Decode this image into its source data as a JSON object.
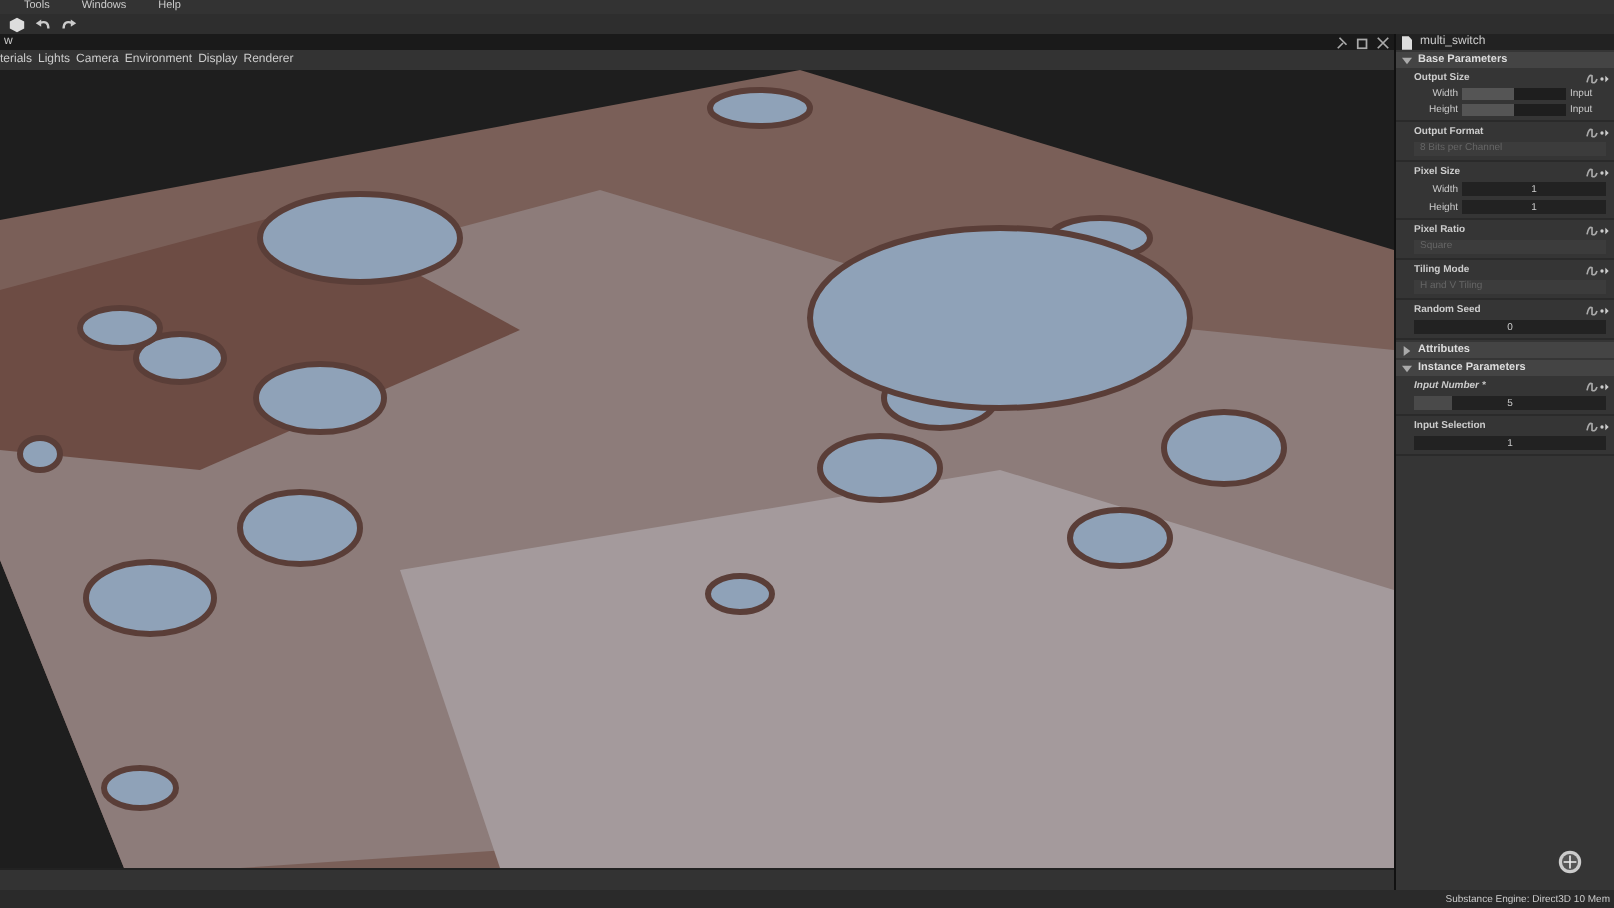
{
  "menu": [
    "Tools",
    "Windows",
    "Help"
  ],
  "viewport": {
    "title": "w",
    "menu": [
      "terials",
      "Lights",
      "Camera",
      "Environment",
      "Display",
      "Renderer"
    ],
    "kind": "picture"
  },
  "panel": {
    "title": "multi_switch",
    "sections": [
      {
        "title": "Base Parameters",
        "expanded": true,
        "groups": [
          {
            "label": "Output Size",
            "italic": false,
            "fields": [
              {
                "label": "Width",
                "kind": "slider",
                "level": 0.5,
                "extra": "Input"
              },
              {
                "label": "Height",
                "kind": "slider",
                "level": 0.5,
                "extra": "Input"
              }
            ]
          },
          {
            "label": "Output Format",
            "italic": false,
            "fields": [
              {
                "kind": "combo",
                "value": "8 Bits per Channel",
                "disabled": true
              }
            ]
          },
          {
            "label": "Pixel Size",
            "italic": false,
            "fields": [
              {
                "label": "Width",
                "kind": "number",
                "value": "1"
              },
              {
                "label": "Height",
                "kind": "number",
                "value": "1"
              }
            ]
          },
          {
            "label": "Pixel Ratio",
            "italic": false,
            "fields": [
              {
                "kind": "combo",
                "value": "Square",
                "disabled": true
              }
            ]
          },
          {
            "label": "Tiling Mode",
            "italic": false,
            "fields": [
              {
                "kind": "combo",
                "value": "H and V Tiling",
                "disabled": true
              }
            ]
          },
          {
            "label": "Random Seed",
            "italic": false,
            "fields": [
              {
                "kind": "number",
                "value": "0"
              }
            ]
          }
        ]
      },
      {
        "title": "Attributes",
        "expanded": false
      },
      {
        "title": "Instance Parameters",
        "expanded": true,
        "groups": [
          {
            "label": "Input Number *",
            "italic": true,
            "fields": [
              {
                "kind": "number",
                "value": "5",
                "level": 0.2
              }
            ]
          },
          {
            "label": "Input Selection",
            "italic": false,
            "fields": [
              {
                "kind": "number",
                "value": "1"
              }
            ]
          }
        ]
      }
    ]
  },
  "status": "Substance Engine: Direct3D 10  Mem"
}
